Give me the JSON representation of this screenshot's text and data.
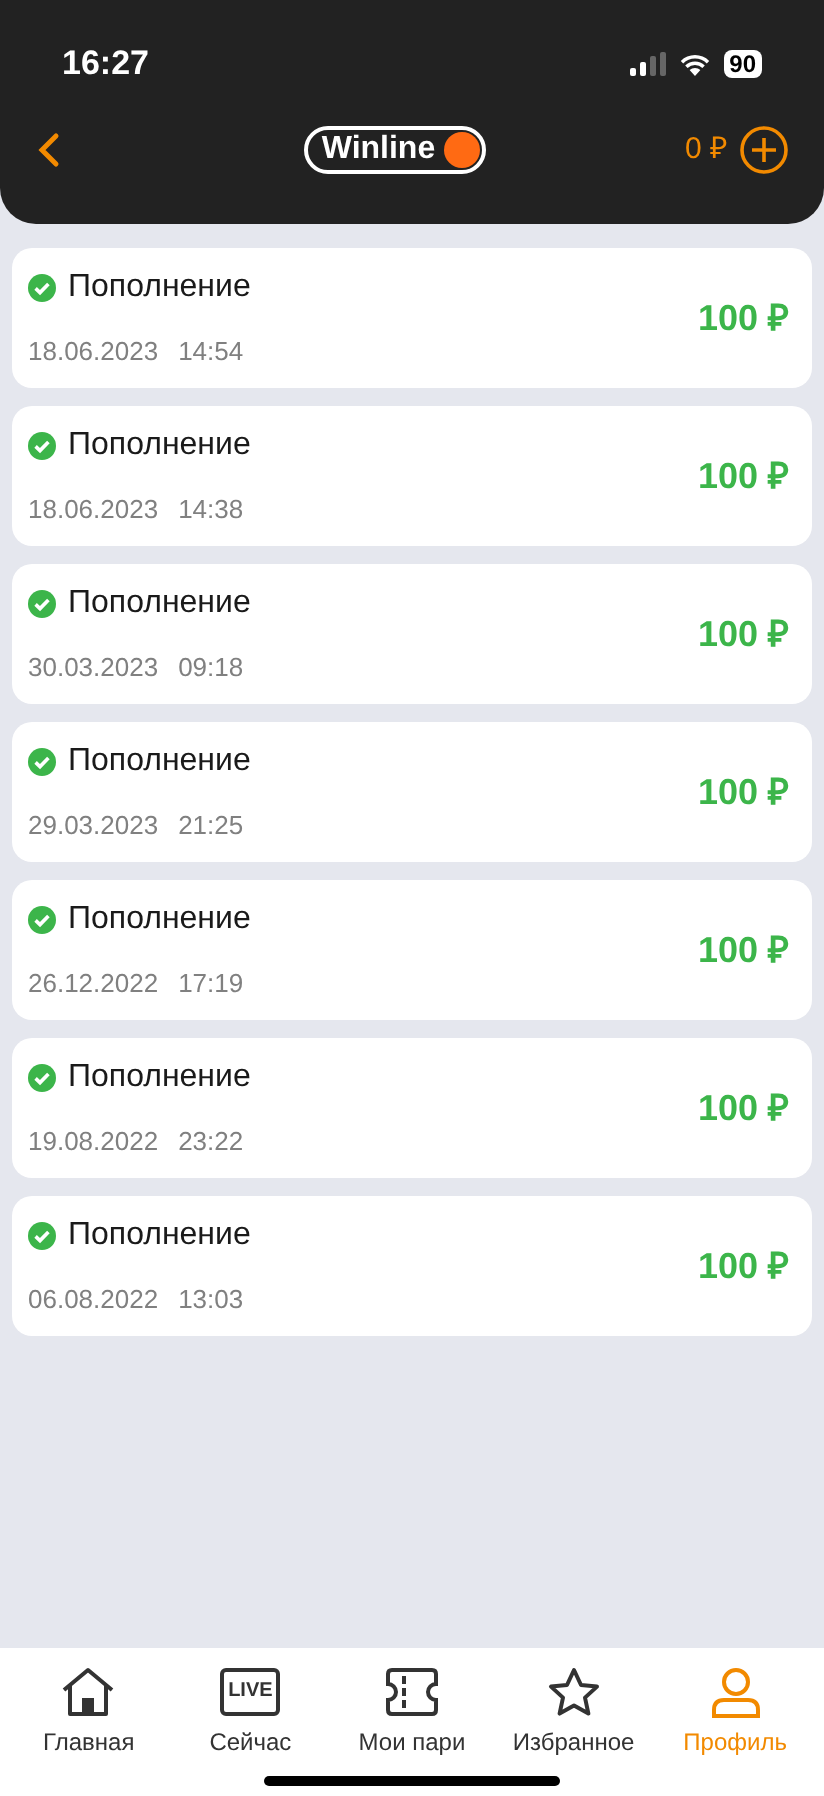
{
  "status_bar": {
    "time": "16:27",
    "battery": "90"
  },
  "header": {
    "logo": "Winline",
    "balance": "0 ₽"
  },
  "transactions": [
    {
      "title": "Пополнение",
      "date": "18.06.2023",
      "time": "14:54",
      "amount": "100 ₽",
      "completed": true
    },
    {
      "title": "Пополнение",
      "date": "18.06.2023",
      "time": "14:38",
      "amount": "100 ₽",
      "completed": true
    },
    {
      "title": "Пополнение",
      "date": "30.03.2023",
      "time": "09:18",
      "amount": "100 ₽",
      "completed": true
    },
    {
      "title": "Пополнение",
      "date": "29.03.2023",
      "time": "21:25",
      "amount": "100 ₽",
      "completed": true
    },
    {
      "title": "Пополнение",
      "date": "26.12.2022",
      "time": "17:19",
      "amount": "100 ₽",
      "completed": true
    },
    {
      "title": "Пополнение",
      "date": "19.08.2022",
      "time": "23:22",
      "amount": "100 ₽",
      "completed": true
    },
    {
      "title": "Пополнение",
      "date": "06.08.2022",
      "time": "13:03",
      "amount": "100 ₽",
      "completed": true
    }
  ],
  "tab_bar": [
    {
      "kind": "home",
      "label": "Главная",
      "selected": false
    },
    {
      "kind": "live",
      "label": "Сейчас",
      "badge": "LIVE",
      "selected": false
    },
    {
      "kind": "ticket",
      "label": "Мои пари",
      "selected": false
    },
    {
      "kind": "star",
      "label": "Избранное",
      "selected": false
    },
    {
      "kind": "person",
      "label": "Профиль",
      "selected": true
    }
  ]
}
